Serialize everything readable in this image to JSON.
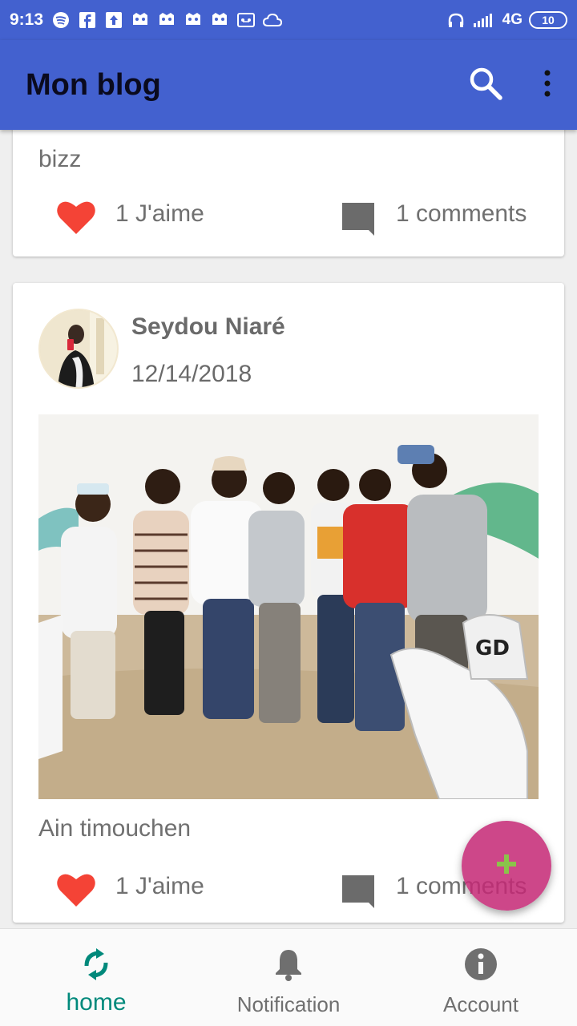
{
  "status_bar": {
    "time": "9:13",
    "network": "4G",
    "battery": "10"
  },
  "app_bar": {
    "title": "Mon blog"
  },
  "posts": [
    {
      "caption": "bizz",
      "likes": "1 J'aime",
      "comments": "1 comments"
    },
    {
      "author": "Seydou Niaré",
      "date": "12/14/2018",
      "caption": "Ain timouchen",
      "likes": "1 J'aime",
      "comments": "1 comments"
    }
  ],
  "bottom_nav": {
    "items": [
      {
        "label": "home",
        "icon": "refresh-icon",
        "active": true
      },
      {
        "label": "Notification",
        "icon": "bell-icon",
        "active": false
      },
      {
        "label": "Account",
        "icon": "info-icon",
        "active": false
      }
    ]
  },
  "colors": {
    "primary": "#4361cf",
    "accent": "#c42774",
    "active_nav": "#00897b",
    "like": "#f44336"
  }
}
